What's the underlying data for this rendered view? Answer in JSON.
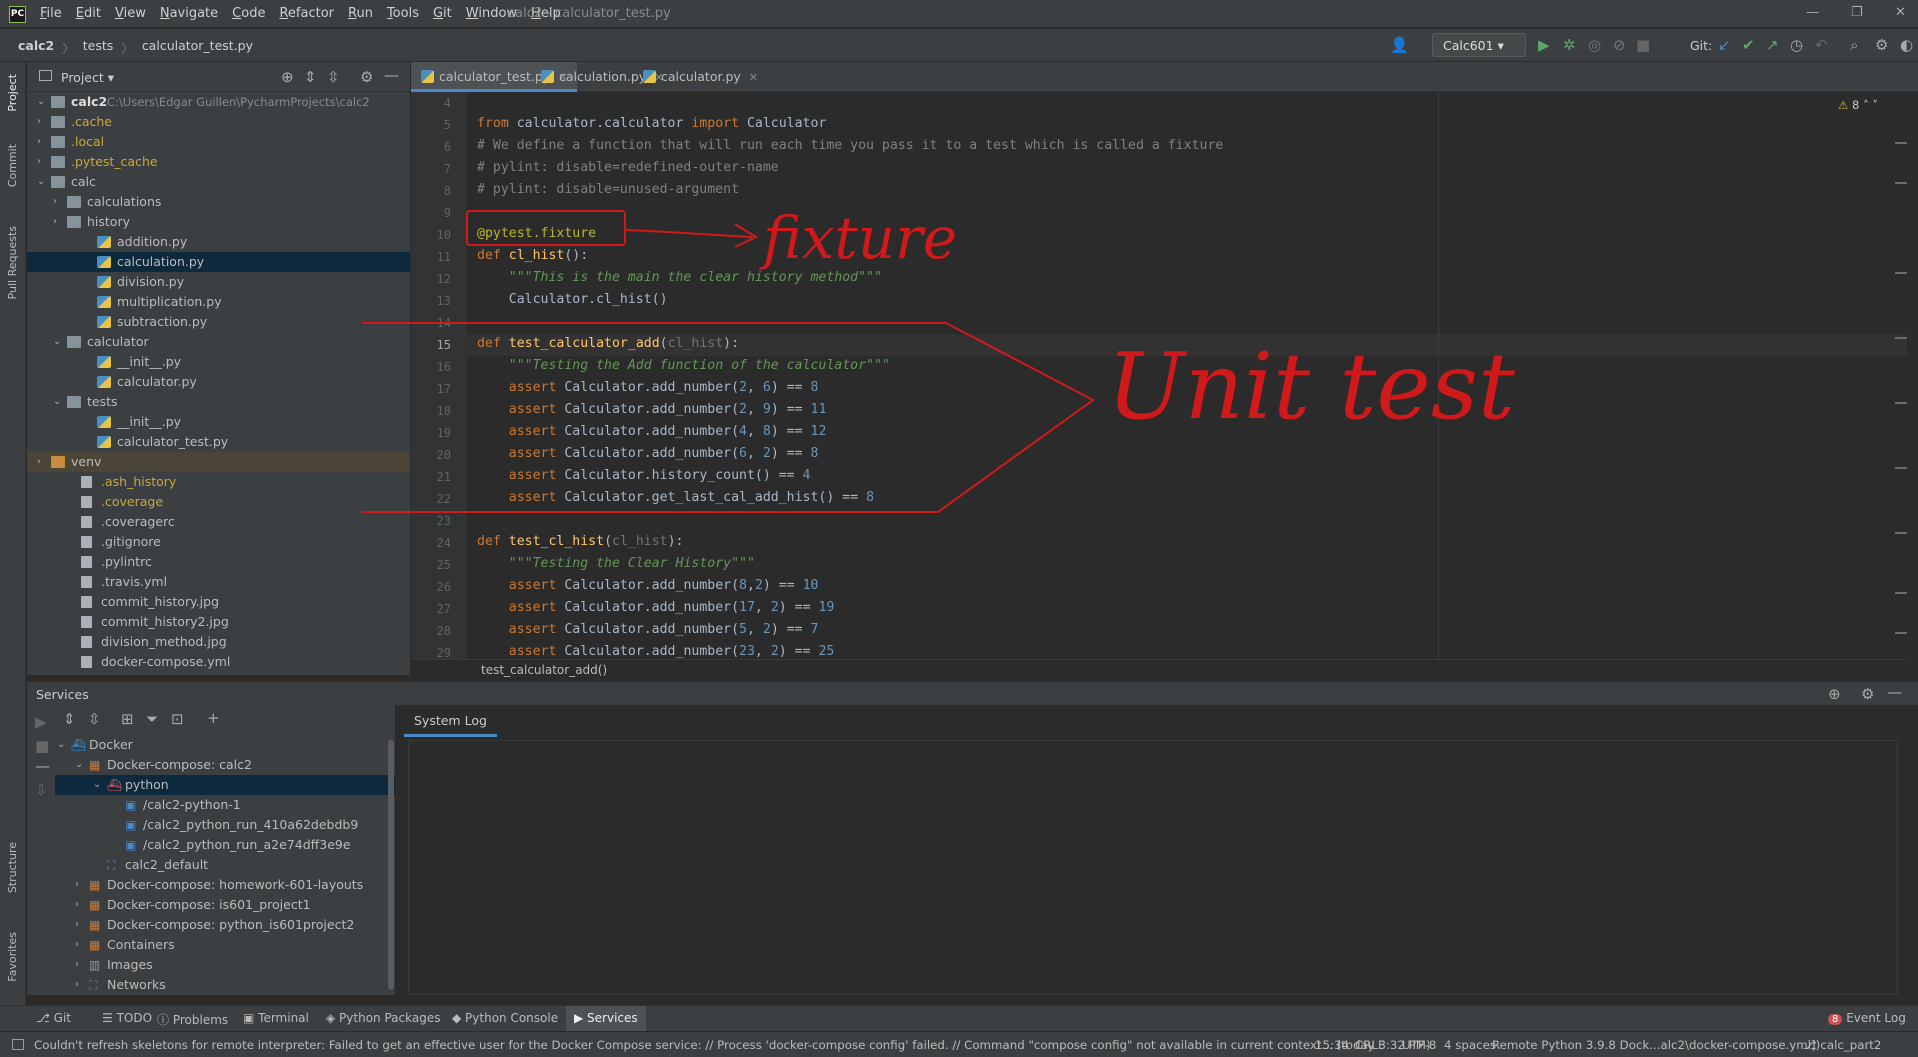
{
  "app": {
    "logo": "PC",
    "window_title": "calc2 - calculator_test.py"
  },
  "menu": [
    "File",
    "Edit",
    "View",
    "Navigate",
    "Code",
    "Refactor",
    "Run",
    "Tools",
    "Git",
    "Window",
    "Help"
  ],
  "breadcrumb": [
    "calc2",
    "tests",
    "calculator_test.py"
  ],
  "toolbar": {
    "run_config": "Calc601",
    "git_label": "Git:"
  },
  "project": {
    "header": "Project",
    "root_name": "calc2",
    "root_path": "C:\\Users\\Edgar Guillen\\PycharmProjects\\calc2"
  },
  "tree": [
    {
      "label": ".cache",
      "depth": 1,
      "type": "folder",
      "color": "#c9a83a",
      "arrow": "›"
    },
    {
      "label": ".local",
      "depth": 1,
      "type": "folder",
      "color": "#c9a83a",
      "arrow": "›"
    },
    {
      "label": ".pytest_cache",
      "depth": 1,
      "type": "folder",
      "color": "#c9a83a",
      "arrow": "›"
    },
    {
      "label": "calc",
      "depth": 1,
      "type": "folder",
      "color": "#bbbbbb",
      "arrow": "⌄"
    },
    {
      "label": "calculations",
      "depth": 2,
      "type": "folder",
      "color": "#bbbbbb",
      "arrow": "›"
    },
    {
      "label": "history",
      "depth": 2,
      "type": "folder",
      "color": "#bbbbbb",
      "arrow": "›"
    },
    {
      "label": "addition.py",
      "depth": 3,
      "type": "py",
      "color": "#bbbbbb"
    },
    {
      "label": "calculation.py",
      "depth": 3,
      "type": "py",
      "color": "#bbbbbb",
      "selected": true
    },
    {
      "label": "division.py",
      "depth": 3,
      "type": "py",
      "color": "#bbbbbb"
    },
    {
      "label": "multiplication.py",
      "depth": 3,
      "type": "py",
      "color": "#bbbbbb"
    },
    {
      "label": "subtraction.py",
      "depth": 3,
      "type": "py",
      "color": "#bbbbbb"
    },
    {
      "label": "calculator",
      "depth": 2,
      "type": "folder",
      "color": "#bbbbbb",
      "arrow": "⌄"
    },
    {
      "label": "__init__.py",
      "depth": 3,
      "type": "py",
      "color": "#bbbbbb"
    },
    {
      "label": "calculator.py",
      "depth": 3,
      "type": "py",
      "color": "#bbbbbb"
    },
    {
      "label": "tests",
      "depth": 2,
      "type": "folder",
      "color": "#bbbbbb",
      "arrow": "⌄"
    },
    {
      "label": "__init__.py",
      "depth": 3,
      "type": "py",
      "color": "#bbbbbb"
    },
    {
      "label": "calculator_test.py",
      "depth": 3,
      "type": "py",
      "color": "#bbbbbb"
    },
    {
      "label": "venv",
      "depth": 1,
      "type": "folder-orange",
      "color": "#bbbbbb",
      "arrow": "›",
      "highlight": true
    },
    {
      "label": ".ash_history",
      "depth": 2,
      "type": "file",
      "color": "#c9a83a"
    },
    {
      "label": ".coverage",
      "depth": 2,
      "type": "file",
      "color": "#c9a83a"
    },
    {
      "label": ".coveragerc",
      "depth": 2,
      "type": "file",
      "color": "#bbbbbb"
    },
    {
      "label": ".gitignore",
      "depth": 2,
      "type": "file",
      "color": "#bbbbbb"
    },
    {
      "label": ".pylintrc",
      "depth": 2,
      "type": "file",
      "color": "#bbbbbb"
    },
    {
      "label": ".travis.yml",
      "depth": 2,
      "type": "file",
      "color": "#bbbbbb"
    },
    {
      "label": "commit_history.jpg",
      "depth": 2,
      "type": "file",
      "color": "#bbbbbb"
    },
    {
      "label": "commit_history2.jpg",
      "depth": 2,
      "type": "file",
      "color": "#bbbbbb"
    },
    {
      "label": "division_method.jpg",
      "depth": 2,
      "type": "file",
      "color": "#bbbbbb"
    },
    {
      "label": "docker-compose.yml",
      "depth": 2,
      "type": "file",
      "color": "#bbbbbb"
    }
  ],
  "tabs": [
    {
      "label": "calculator_test.py",
      "active": true
    },
    {
      "label": "calculation.py",
      "active": false
    },
    {
      "label": "calculator.py",
      "active": false
    }
  ],
  "editor": {
    "warnings": "8",
    "context_crumb": "test_calculator_add()",
    "lines": [
      {
        "n": "4",
        "html": ""
      },
      {
        "n": "5",
        "html": "<span class='kw'>from</span> calculator.calculator <span class='kw'>import</span> Calculator"
      },
      {
        "n": "6",
        "html": "<span class='cm'># We define a function that will run each time you pass it to a test which is called a fixture</span>"
      },
      {
        "n": "7",
        "html": "<span class='cm'># pylint: disable=redefined-outer-name</span>"
      },
      {
        "n": "8",
        "html": "<span class='cm'># pylint: disable=unused-argument</span>"
      },
      {
        "n": "9",
        "html": ""
      },
      {
        "n": "10",
        "html": "<span class='dec'>@pytest.fixture</span>"
      },
      {
        "n": "11",
        "html": "<span class='kw'>def</span> <span class='fn'>cl_hist</span>():"
      },
      {
        "n": "12",
        "html": "    <span class='doc'>\"\"\"This is the main the clear history method\"\"\"</span>"
      },
      {
        "n": "13",
        "html": "    Calculator.cl_hist()"
      },
      {
        "n": "14",
        "html": ""
      },
      {
        "n": "15",
        "html": "<span class='kw'>def</span> <span class='fn'>test_calculator_add</span>(<span class='par'>cl_hist</span>):"
      },
      {
        "n": "16",
        "html": "    <span class='doc'>\"\"\"Testing the Add function of the calculator\"\"\"</span>"
      },
      {
        "n": "17",
        "html": "    <span class='kw'>assert</span> Calculator.add_number(<span class='num'>2</span>, <span class='num'>6</span>) == <span class='num'>8</span>"
      },
      {
        "n": "18",
        "html": "    <span class='kw'>assert</span> Calculator.add_number(<span class='num'>2</span>, <span class='num'>9</span>) == <span class='num'>11</span>"
      },
      {
        "n": "19",
        "html": "    <span class='kw'>assert</span> Calculator.add_number(<span class='num'>4</span>, <span class='num'>8</span>) == <span class='num'>12</span>"
      },
      {
        "n": "20",
        "html": "    <span class='kw'>assert</span> Calculator.add_number(<span class='num'>6</span>, <span class='num'>2</span>) == <span class='num'>8</span>"
      },
      {
        "n": "21",
        "html": "    <span class='kw'>assert</span> Calculator.history_count() == <span class='num'>4</span>"
      },
      {
        "n": "22",
        "html": "    <span class='kw'>assert</span> Calculator.get_last_cal_add_hist() == <span class='num'>8</span>"
      },
      {
        "n": "23",
        "html": ""
      },
      {
        "n": "24",
        "html": "<span class='kw'>def</span> <span class='fn'>test_cl_hist</span>(<span class='par'>cl_hist</span>):"
      },
      {
        "n": "25",
        "html": "    <span class='doc'>\"\"\"Testing the Clear History\"\"\"</span>"
      },
      {
        "n": "26",
        "html": "    <span class='kw'>assert</span> Calculator.add_number(<span class='num'>8</span>,<span class='num'>2</span>) == <span class='num'>10</span>"
      },
      {
        "n": "27",
        "html": "    <span class='kw'>assert</span> Calculator.add_number(<span class='num'>17</span>, <span class='num'>2</span>) == <span class='num'>19</span>"
      },
      {
        "n": "28",
        "html": "    <span class='kw'>assert</span> Calculator.add_number(<span class='num'>5</span>, <span class='num'>2</span>) == <span class='num'>7</span>"
      },
      {
        "n": "29",
        "html": "    <span class='kw'>assert</span> Calculator.add_number(<span class='num'>23</span>, <span class='num'>2</span>) == <span class='num'>25</span>"
      }
    ]
  },
  "annotations": {
    "fixture": "fixture",
    "unit_test": "Unit test"
  },
  "services": {
    "header": "Services",
    "log_tab": "System Log",
    "tree": [
      {
        "label": "Docker",
        "depth": 0,
        "arrow": "⌄",
        "icon": "docker"
      },
      {
        "label": "Docker-compose: calc2",
        "depth": 1,
        "arrow": "⌄",
        "icon": "compose"
      },
      {
        "label": "python",
        "depth": 2,
        "arrow": "⌄",
        "icon": "python",
        "selected": true
      },
      {
        "label": "/calc2-python-1",
        "depth": 3,
        "icon": "container"
      },
      {
        "label": "/calc2_python_run_410a62debdb9",
        "depth": 3,
        "icon": "container"
      },
      {
        "label": "/calc2_python_run_a2e74dff3e9e",
        "depth": 3,
        "icon": "container"
      },
      {
        "label": "calc2_default",
        "depth": 2,
        "icon": "network"
      },
      {
        "label": "Docker-compose: homework-601-layouts",
        "depth": 1,
        "arrow": "›",
        "icon": "compose"
      },
      {
        "label": "Docker-compose: is601_project1",
        "depth": 1,
        "arrow": "›",
        "icon": "compose"
      },
      {
        "label": "Docker-compose: python_is601project2",
        "depth": 1,
        "arrow": "›",
        "icon": "compose"
      },
      {
        "label": "Containers",
        "depth": 1,
        "arrow": "›",
        "icon": "compose"
      },
      {
        "label": "Images",
        "depth": 1,
        "arrow": "›",
        "icon": "images"
      },
      {
        "label": "Networks",
        "depth": 1,
        "arrow": "›",
        "icon": "network"
      }
    ]
  },
  "left_vtabs": [
    "Project",
    "Commit",
    "Pull Requests",
    "Structure",
    "Favorites"
  ],
  "bottom_tabs": [
    {
      "label": "Git",
      "active": false
    },
    {
      "label": "TODO",
      "active": false
    },
    {
      "label": "Problems",
      "active": false
    },
    {
      "label": "Terminal",
      "active": false
    },
    {
      "label": "Python Packages",
      "active": false
    },
    {
      "label": "Python Console",
      "active": false
    },
    {
      "label": "Services",
      "active": true
    }
  ],
  "event_log": {
    "count": "8",
    "label": "Event Log"
  },
  "status": {
    "message": "Couldn't refresh skeletons for remote interpreter: Failed to get an effective user for the Docker Compose service: // Process 'docker-compose config' failed. // Command \"compose config\" not available in current context... (today 3:32 PM)",
    "position": "15:34",
    "line_sep": "CRLF",
    "encoding": "UTF-8",
    "indent": "4 spaces",
    "interpreter": "Remote Python 3.9.8 Dock...alc2\\docker-compose.yml])",
    "branch": "calc_part2"
  }
}
